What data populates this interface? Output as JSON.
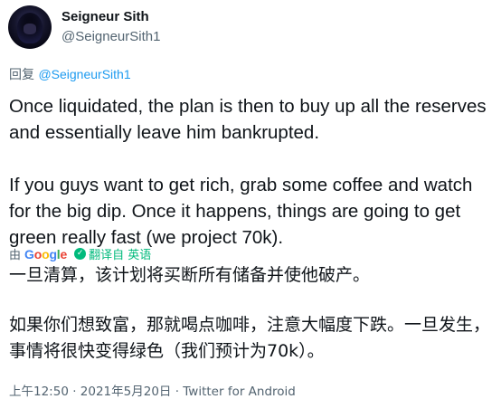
{
  "author": {
    "display_name": "Seigneur Sith",
    "handle": "@SeigneurSith1"
  },
  "reply": {
    "prefix": "回复",
    "mention": "@SeigneurSith1"
  },
  "tweet": {
    "paragraph_1": "Once liquidated, the plan is then to buy up all the reserves and essentially leave him bankrupted.",
    "paragraph_2": "If you guys want to get rich, grab some coffee and watch for the big dip. Once it happens, things are going to get green really fast (we project 70k)."
  },
  "translation": {
    "by_label": "由",
    "provider": "Google",
    "translated_from_label": "翻译自 英语",
    "paragraph_1": "一旦清算，该计划将买断所有储备并使他破产。",
    "paragraph_2": "如果你们想致富，那就喝点咖啡，注意大幅度下跌。一旦发生，事情将很快变得绿色（我们预计为70k）。"
  },
  "meta": {
    "time": "上午12:50",
    "separator_1": " · ",
    "date": "2021年5月20日",
    "separator_2": " · ",
    "source": "Twitter for Android"
  },
  "colors": {
    "text": "#0f1419",
    "secondary": "#536471",
    "link": "#1d9bf0",
    "translate_green": "#00ba7c"
  }
}
